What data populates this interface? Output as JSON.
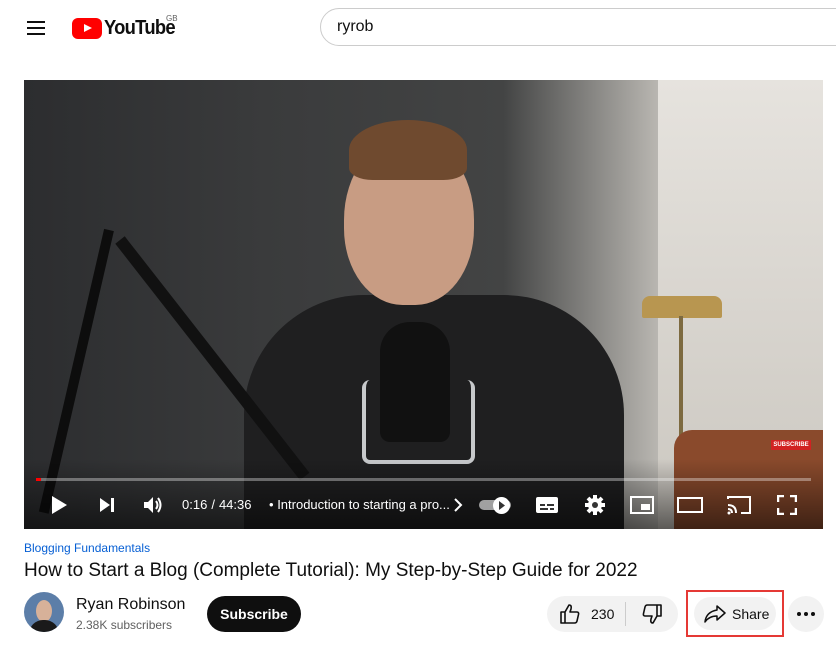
{
  "header": {
    "logo_text": "YouTube",
    "region": "GB",
    "search_value": "ryrob"
  },
  "player": {
    "progress_fraction": 0.006,
    "current_time": "0:16",
    "separator": "/",
    "duration": "44:36",
    "chapter_bullet": "•",
    "chapter": "Introduction to starting a pro...",
    "overlay_subscribe": "SUBSCRIBE",
    "autoplay_on": true
  },
  "video": {
    "hashtag": "Blogging Fundamentals",
    "title": "How to Start a Blog (Complete Tutorial): My Step-by-Step Guide for 2022"
  },
  "channel": {
    "name": "Ryan Robinson",
    "subscribers": "2.38K subscribers",
    "subscribe_label": "Subscribe"
  },
  "actions": {
    "like_count": "230",
    "share_label": "Share",
    "highlight_color": "#e53935"
  },
  "icons": [
    "menu-icon",
    "youtube-logo-icon",
    "play-icon",
    "next-icon",
    "volume-icon",
    "chevron-right-icon",
    "subtitles-icon",
    "settings-gear-icon",
    "miniplayer-icon",
    "theater-mode-icon",
    "cast-icon",
    "fullscreen-icon",
    "thumbs-up-icon",
    "thumbs-down-icon",
    "share-arrow-icon",
    "more-dots-icon"
  ]
}
